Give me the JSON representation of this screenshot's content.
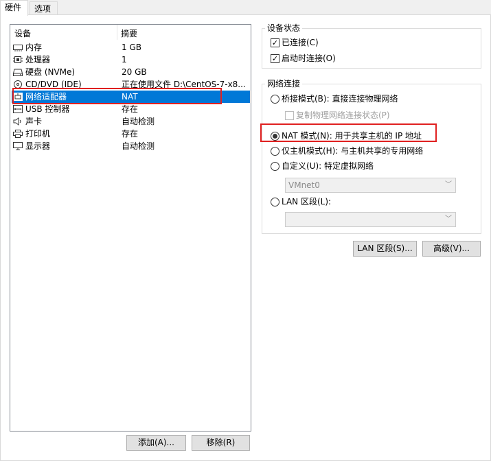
{
  "tabs": [
    {
      "label": "硬件",
      "active": true
    },
    {
      "label": "选项",
      "active": false
    }
  ],
  "device_list": {
    "columns": [
      "设备",
      "摘要"
    ],
    "rows": [
      {
        "icon": "memory-icon",
        "name": "内存",
        "summary": "1 GB"
      },
      {
        "icon": "processor-icon",
        "name": "处理器",
        "summary": "1"
      },
      {
        "icon": "hard-disk-icon",
        "name": "硬盘 (NVMe)",
        "summary": "20 GB"
      },
      {
        "icon": "cd-dvd-icon",
        "name": "CD/DVD (IDE)",
        "summary": "正在使用文件 D:\\CentOS-7-x8..."
      },
      {
        "icon": "network-adapter-icon",
        "name": "网络适配器",
        "summary": "NAT",
        "selected": true
      },
      {
        "icon": "usb-icon",
        "name": "USB 控制器",
        "summary": "存在"
      },
      {
        "icon": "sound-card-icon",
        "name": "声卡",
        "summary": "自动检测"
      },
      {
        "icon": "printer-icon",
        "name": "打印机",
        "summary": "存在"
      },
      {
        "icon": "display-icon",
        "name": "显示器",
        "summary": "自动检测"
      }
    ]
  },
  "buttons": {
    "add": "添加(A)...",
    "remove": "移除(R)",
    "lan_segments": "LAN 区段(S)...",
    "advanced": "高级(V)..."
  },
  "device_status": {
    "title": "设备状态",
    "connected": {
      "label": "已连接(C)",
      "checked": true
    },
    "connect_at_power_on": {
      "label": "启动时连接(O)",
      "checked": true
    }
  },
  "network_connection": {
    "title": "网络连接",
    "bridged": {
      "label": "桥接模式(B): 直接连接物理网络",
      "selected": false
    },
    "replicate": {
      "label": "复制物理网络连接状态(P)",
      "checked": false,
      "enabled": false
    },
    "nat": {
      "label": "NAT 模式(N): 用于共享主机的 IP 地址",
      "selected": true
    },
    "host_only": {
      "label": "仅主机模式(H): 与主机共享的专用网络",
      "selected": false
    },
    "custom": {
      "label": "自定义(U): 特定虚拟网络",
      "selected": false
    },
    "custom_value": "VMnet0",
    "lan_segment": {
      "label": "LAN 区段(L):",
      "selected": false
    },
    "lan_segment_value": ""
  },
  "colors": {
    "selection": "#0078d7",
    "highlight_box": "#e02020"
  }
}
